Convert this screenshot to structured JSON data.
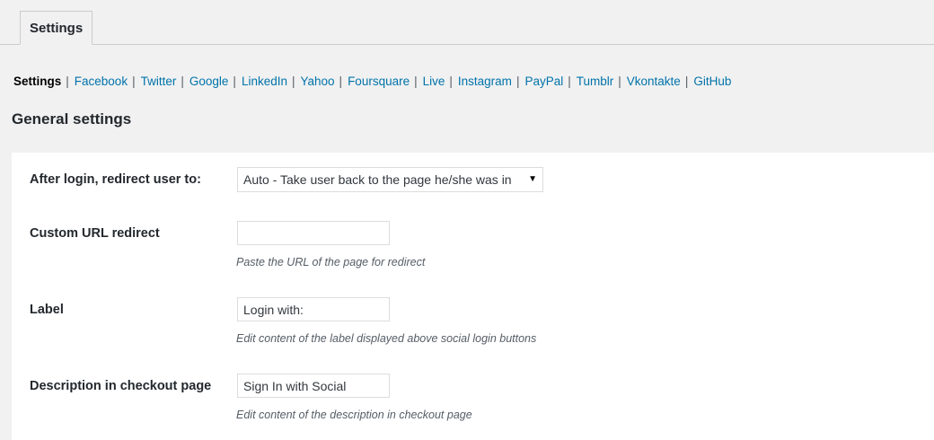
{
  "tabs": [
    {
      "label": "Settings"
    }
  ],
  "subnav": {
    "current": "Settings",
    "separator": "|",
    "links": [
      "Facebook",
      "Twitter",
      "Google",
      "LinkedIn",
      "Yahoo",
      "Foursquare",
      "Live",
      "Instagram",
      "PayPal",
      "Tumblr",
      "Vkontakte",
      "GitHub"
    ]
  },
  "section": {
    "title": "General settings"
  },
  "form": {
    "redirect": {
      "label": "After login, redirect user to:",
      "selected": "Auto - Take user back to the page he/she was in",
      "arrow": "▼"
    },
    "custom_url": {
      "label": "Custom URL redirect",
      "value": "",
      "help": "Paste the URL of the page for redirect"
    },
    "login_label": {
      "label": "Label",
      "value": "Login with:",
      "help": "Edit content of the label displayed above social login buttons"
    },
    "checkout_description": {
      "label": "Description in checkout page",
      "value": "Sign In with Social",
      "help": "Edit content of the description in checkout page"
    }
  },
  "colors": {
    "background": "#f1f1f1",
    "panel": "#ffffff",
    "link": "#0073aa",
    "text": "#23282d",
    "help_text": "#555d66"
  }
}
